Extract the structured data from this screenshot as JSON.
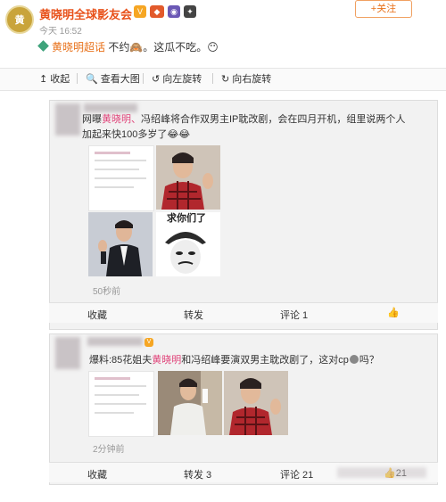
{
  "account": {
    "name": "黄晓明全球影友会",
    "avatar_text": "黄",
    "follow_label": "+关注",
    "time": "今天 16:52",
    "post_link": "黄晓明超话",
    "post_text": " 不约🙈。这瓜不吃。😶"
  },
  "toolbar": {
    "collapse": "收起",
    "view_large": "查看大图",
    "rotate_left": "向左旋转",
    "rotate_right": "向右旋转"
  },
  "card1": {
    "line1_prefix": "网曝",
    "line1_name": "黄晓明、",
    "line1_rest": "冯绍峰将合作双男主IP耽改剧，会在四月开机，组里说两个人",
    "line2": "加起来快100多岁了😂😂",
    "sticker_text": "求你们了",
    "timestamp": "50秒前",
    "actions": {
      "favorite": "收藏",
      "repost": "转发",
      "comment": "评论 1"
    }
  },
  "card2": {
    "line_prefix": "爆料:85花姐夫",
    "line_name": "黄晓明",
    "line_rest": "和冯绍峰要演双男主耽改剧了，这对cp",
    "line_end": "吗？",
    "timestamp": "2分钟前",
    "actions": {
      "favorite": "收藏",
      "repost": "转发 3",
      "comment": "评论 21",
      "like": "21"
    }
  },
  "icons": [
    "verified-v-icon",
    "badge-icon",
    "rotate-left-icon",
    "rotate-right-icon",
    "zoom-icon",
    "collapse-arrow-icon",
    "like-icon"
  ],
  "colors": {
    "accent": "#e8711a",
    "name": "#e8511a",
    "pink": "#e0447a",
    "green": "#3fa37b"
  }
}
